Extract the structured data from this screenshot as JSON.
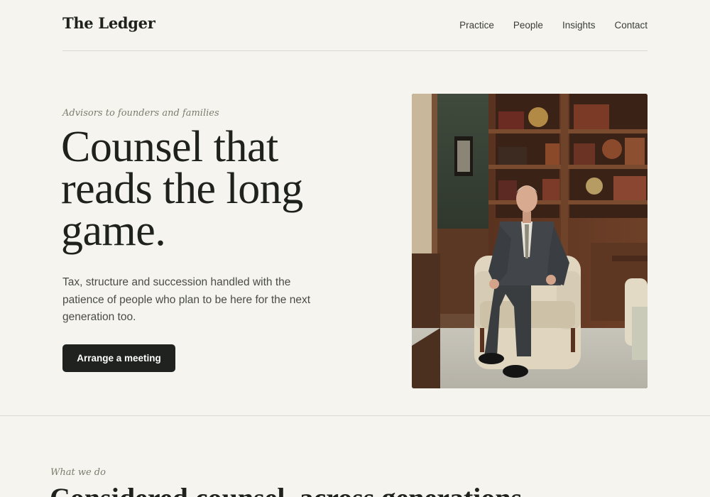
{
  "header": {
    "logo": "The Ledger",
    "nav": [
      "Practice",
      "People",
      "Insights",
      "Contact"
    ]
  },
  "hero": {
    "eyebrow": "Advisors to founders and families",
    "headline": "Counsel that reads the long game.",
    "lede": "Tax, structure and succession handled with the patience of people who plan to be here for the next generation too.",
    "cta": "Arrange a meeting"
  },
  "photo": {
    "icon": "portrait-photo"
  },
  "section": {
    "eyebrow": "What we do",
    "title": "Considered counsel, across generations"
  },
  "colors": {
    "background": "#f5f4ee",
    "text": "#1f211d",
    "button": "#1f221f",
    "muted": "#7a7d6e"
  }
}
